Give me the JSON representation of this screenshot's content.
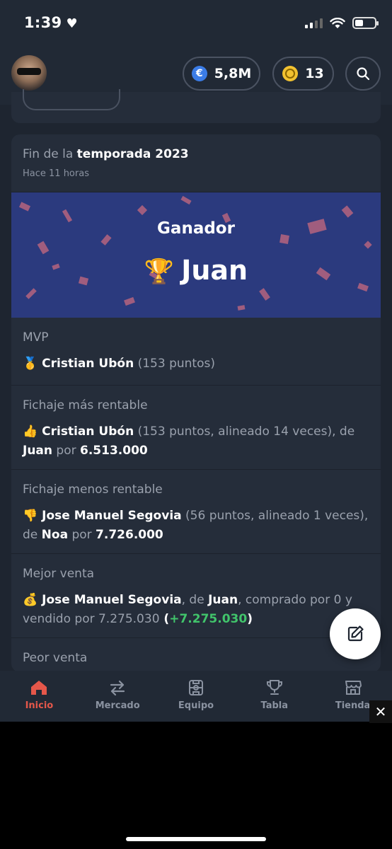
{
  "status": {
    "time": "1:39"
  },
  "header": {
    "money": "5,8M",
    "coins": "13"
  },
  "card": {
    "title_prefix": "Fin de la ",
    "title_bold": "temporada 2023",
    "subtitle": "Hace 11 horas",
    "banner": {
      "label": "Ganador",
      "winner": "Juan"
    },
    "sections": {
      "mvp": {
        "title": "MVP",
        "emoji": "🥇",
        "player": "Cristian Ubón",
        "detail": "(153 puntos)"
      },
      "best_signing": {
        "title": "Fichaje más rentable",
        "emoji": "👍",
        "player": "Cristian Ubón",
        "detail": "(153 puntos, alineado 14 veces), de",
        "owner": "Juan",
        "price_label": "por",
        "price": "6.513.000"
      },
      "worst_signing": {
        "title": "Fichaje menos rentable",
        "emoji": "👎",
        "player": "Jose Manuel Segovia",
        "detail": "(56 puntos, alineado 1 veces), de",
        "owner": "Noa",
        "price_label": "por",
        "price": "7.726.000"
      },
      "best_sale": {
        "title": "Mejor venta",
        "emoji": "💰",
        "player": "Jose Manuel Segovia",
        "of_label": ", de",
        "owner": "Juan",
        "detail": ", comprado por 0 y vendido por 7.275.030",
        "open_paren": " (",
        "gain": "+7.275.030",
        "close_paren": ")"
      },
      "worst_sale": {
        "title": "Peor venta"
      }
    }
  },
  "tabs": [
    {
      "label": "Inicio"
    },
    {
      "label": "Mercado"
    },
    {
      "label": "Equipo"
    },
    {
      "label": "Tabla"
    },
    {
      "label": "Tienda"
    }
  ],
  "colors": {
    "accent": "#e5574a",
    "background": "#1e2530",
    "card": "#252d3a",
    "banner": "#2b3a7e",
    "gain": "#41c46b"
  }
}
